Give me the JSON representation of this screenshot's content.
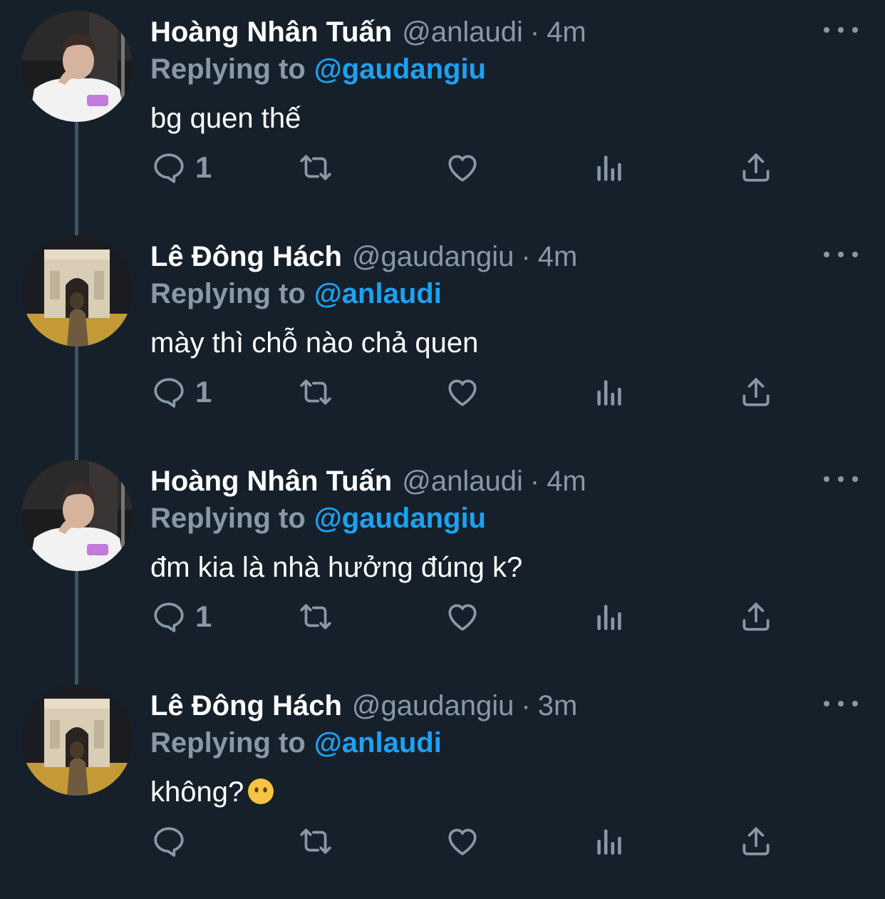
{
  "colors": {
    "background": "#15202b",
    "primary_text": "#ffffff",
    "secondary_text": "#8899a6",
    "mention": "#1da1f2",
    "thread_line": "#3d5466"
  },
  "tweets": [
    {
      "name": "Hoàng Nhân Tuấn",
      "handle": "@anlaudi",
      "sep": "·",
      "time": "4m",
      "replying_label": "Replying to",
      "replying_to": "@gaudangiu",
      "text": "bg quen thế",
      "emoji": "",
      "reply_count": "1",
      "avatar_icon": "avatar-person-white-shirt"
    },
    {
      "name": "Lê Đông Hách",
      "handle": "@gaudangiu",
      "sep": "·",
      "time": "4m",
      "replying_label": "Replying to",
      "replying_to": "@anlaudi",
      "text": "mày thì chỗ nào chả quen",
      "emoji": "",
      "reply_count": "1",
      "avatar_icon": "avatar-arc-de-triomphe"
    },
    {
      "name": "Hoàng Nhân Tuấn",
      "handle": "@anlaudi",
      "sep": "·",
      "time": "4m",
      "replying_label": "Replying to",
      "replying_to": "@gaudangiu",
      "text": "đm kia là nhà hưởng đúng k?",
      "emoji": "",
      "reply_count": "1",
      "avatar_icon": "avatar-person-white-shirt"
    },
    {
      "name": "Lê Đông Hách",
      "handle": "@gaudangiu",
      "sep": "·",
      "time": "3m",
      "replying_label": "Replying to",
      "replying_to": "@anlaudi",
      "text": "không?",
      "emoji": "face-without-mouth-emoji",
      "reply_count": "",
      "avatar_icon": "avatar-arc-de-triomphe"
    }
  ],
  "icons": {
    "reply": "reply-icon",
    "retweet": "retweet-icon",
    "like": "like-icon",
    "analytics": "analytics-icon",
    "share": "share-icon",
    "more": "more-icon"
  }
}
